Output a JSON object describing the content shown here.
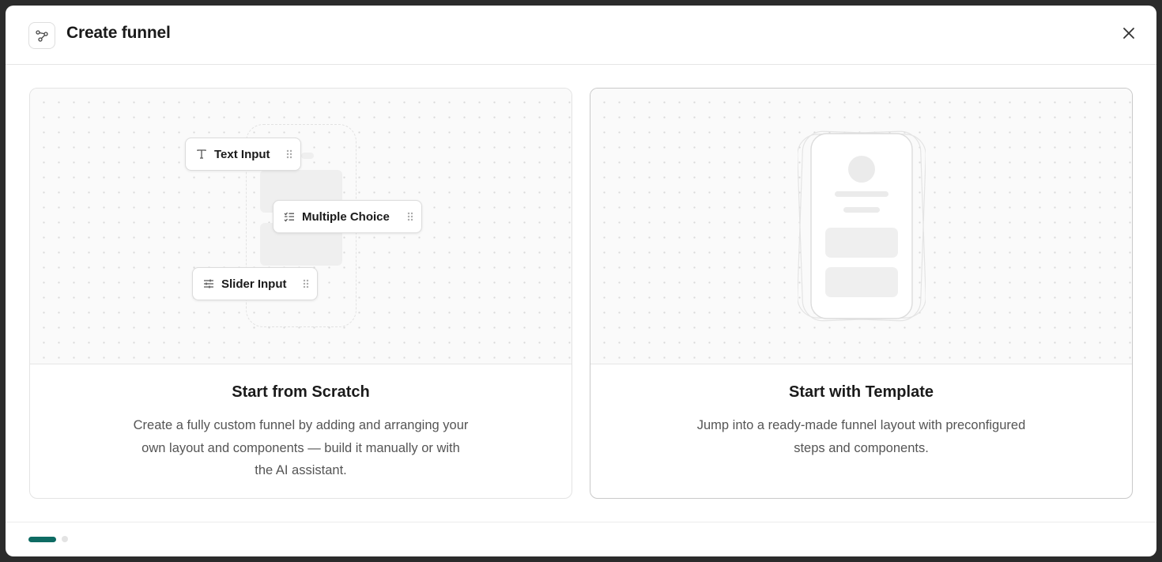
{
  "header": {
    "title": "Create funnel",
    "icon": "funnel-nodes-icon",
    "close_icon": "close-icon"
  },
  "options": [
    {
      "title": "Start from Scratch",
      "description": "Create a fully custom funnel by adding and arranging your own layout and components — build it manually or with the AI assistant.",
      "chips": [
        {
          "label": "Text Input",
          "icon": "text-icon"
        },
        {
          "label": "Multiple Choice",
          "icon": "checklist-icon"
        },
        {
          "label": "Slider Input",
          "icon": "sliders-icon"
        }
      ]
    },
    {
      "title": "Start with Template",
      "description": "Jump into a ready-made funnel layout with preconfigured steps and components."
    }
  ],
  "pagination": {
    "current": 1,
    "total": 2
  },
  "colors": {
    "accent": "#0e6b63",
    "dot_inactive": "#e3e3e3"
  }
}
